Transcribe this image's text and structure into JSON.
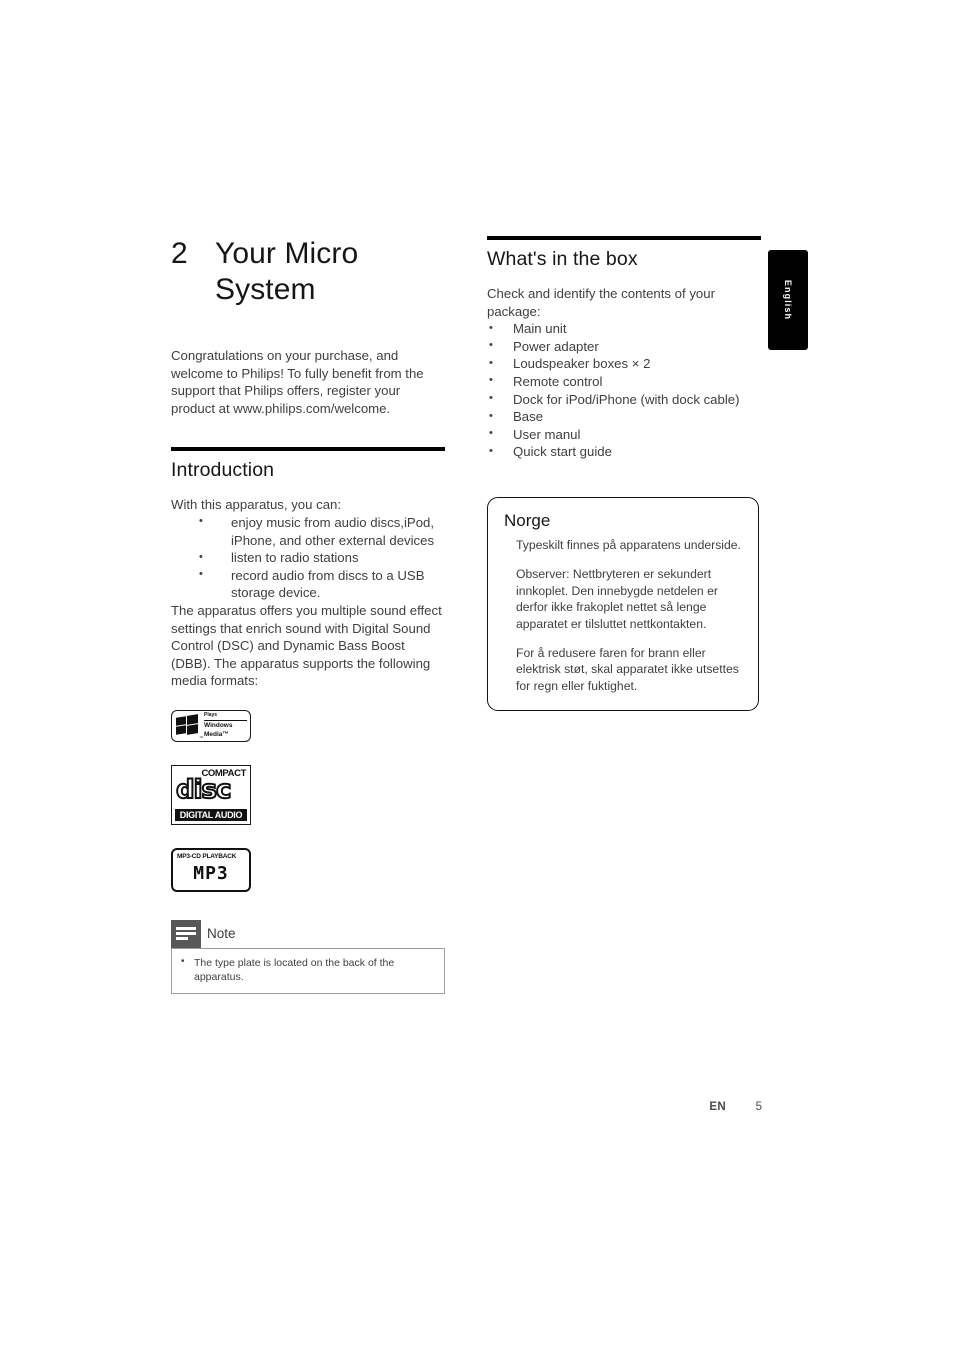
{
  "document": {
    "language_tab": "English",
    "footer": {
      "locale_code": "EN",
      "page_number": "5"
    }
  },
  "chapter": {
    "number": "2",
    "title": "Your Micro System",
    "intro_paragraph": "Congratulations on your purchase, and welcome to Philips! To fully benefit from the support that Philips offers, register your product at www.philips.com/welcome."
  },
  "introduction": {
    "heading": "Introduction",
    "lead": "With this apparatus, you can:",
    "capabilities": [
      "enjoy music from audio discs,iPod, iPhone, and other external devices",
      "listen to radio stations",
      "record audio from discs to a USB storage device."
    ],
    "body": "The apparatus offers you multiple sound effect settings that enrich sound with Digital Sound Control (DSC) and Dynamic Bass Boost (DBB). The apparatus supports the following media formats:",
    "logos": {
      "windows_media": {
        "plays": "Plays",
        "brand_line1": "Windows",
        "brand_line2": "Media™",
        "tm": "™"
      },
      "compact_disc": {
        "compact": "COMPACT",
        "disc": "disc",
        "digital_audio": "DIGITAL AUDIO"
      },
      "mp3": {
        "caption": "MP3-CD PLAYBACK",
        "wordmark": "MP3"
      }
    }
  },
  "note": {
    "title": "Note",
    "items": [
      "The type plate is located on the back of the apparatus."
    ]
  },
  "whats_in_the_box": {
    "heading": "What's in the box",
    "lead": "Check and identify the contents of your package:",
    "items": [
      "Main unit",
      "Power adapter",
      "Loudspeaker boxes × 2",
      "Remote control",
      "Dock for iPod/iPhone (with dock cable)",
      "Base",
      "User manul",
      "Quick start guide"
    ]
  },
  "norge_callout": {
    "title": "Norge",
    "paragraphs": [
      "Typeskilt finnes på apparatens underside.",
      "Observer: Nettbryteren er sekundert innkoplet. Den innebygde netdelen er derfor ikke frakoplet nettet så lenge apparatet er tilsluttet nettkontakten.",
      "For å redusere faren for brann eller elektrisk støt, skal apparatet ikke utsettes for regn eller fuktighet."
    ]
  },
  "colors": {
    "rule": "#000000",
    "note_icon_bg": "#58585a",
    "tab_bg": "#000000",
    "body_text": "#3f3f41"
  }
}
